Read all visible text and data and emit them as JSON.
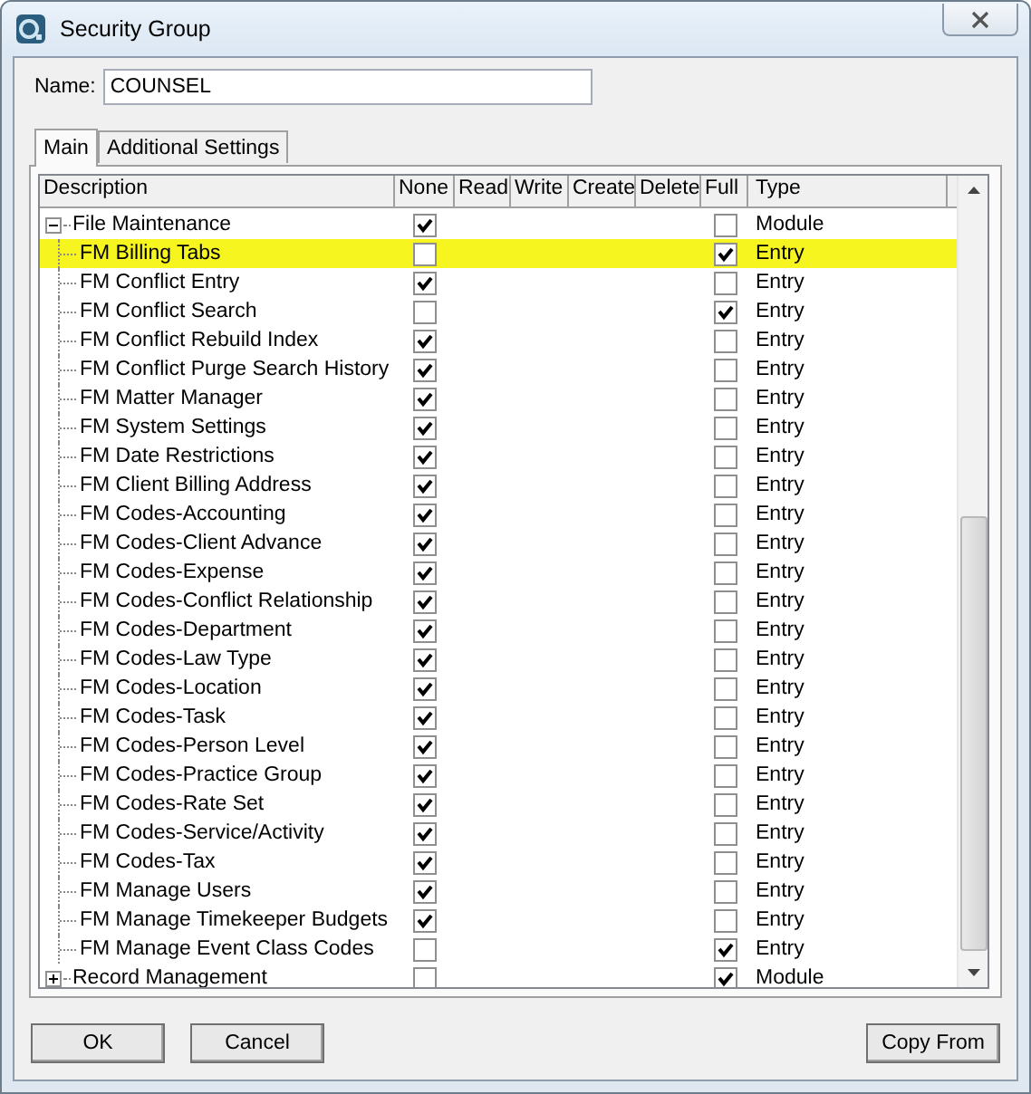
{
  "window": {
    "title": "Security Group"
  },
  "name_field": {
    "label": "Name:",
    "value": "COUNSEL"
  },
  "tabs": [
    {
      "label": "Main",
      "selected": true
    },
    {
      "label": "Additional Settings",
      "selected": false
    }
  ],
  "table": {
    "columns": [
      "Description",
      "None",
      "Read",
      "Write",
      "Create",
      "Delete",
      "Full",
      "Type"
    ],
    "rows": [
      {
        "description": "File Maintenance",
        "expanded": true,
        "none": true,
        "full": false,
        "type": "Module",
        "highlighted": false,
        "children": [
          {
            "description": "FM Billing Tabs",
            "none": false,
            "full": true,
            "type": "Entry",
            "highlighted": true
          },
          {
            "description": "FM Conflict Entry",
            "none": true,
            "full": false,
            "type": "Entry",
            "highlighted": false
          },
          {
            "description": "FM Conflict Search",
            "none": false,
            "full": true,
            "type": "Entry",
            "highlighted": false
          },
          {
            "description": "FM Conflict Rebuild Index",
            "none": true,
            "full": false,
            "type": "Entry",
            "highlighted": false
          },
          {
            "description": "FM Conflict Purge Search History",
            "none": true,
            "full": false,
            "type": "Entry",
            "highlighted": false
          },
          {
            "description": "FM Matter Manager",
            "none": true,
            "full": false,
            "type": "Entry",
            "highlighted": false
          },
          {
            "description": "FM System Settings",
            "none": true,
            "full": false,
            "type": "Entry",
            "highlighted": false
          },
          {
            "description": "FM Date Restrictions",
            "none": true,
            "full": false,
            "type": "Entry",
            "highlighted": false
          },
          {
            "description": "FM Client Billing Address",
            "none": true,
            "full": false,
            "type": "Entry",
            "highlighted": false
          },
          {
            "description": "FM Codes-Accounting",
            "none": true,
            "full": false,
            "type": "Entry",
            "highlighted": false
          },
          {
            "description": "FM Codes-Client Advance",
            "none": true,
            "full": false,
            "type": "Entry",
            "highlighted": false
          },
          {
            "description": "FM Codes-Expense",
            "none": true,
            "full": false,
            "type": "Entry",
            "highlighted": false
          },
          {
            "description": "FM Codes-Conflict Relationship",
            "none": true,
            "full": false,
            "type": "Entry",
            "highlighted": false
          },
          {
            "description": "FM Codes-Department",
            "none": true,
            "full": false,
            "type": "Entry",
            "highlighted": false
          },
          {
            "description": "FM Codes-Law Type",
            "none": true,
            "full": false,
            "type": "Entry",
            "highlighted": false
          },
          {
            "description": "FM Codes-Location",
            "none": true,
            "full": false,
            "type": "Entry",
            "highlighted": false
          },
          {
            "description": "FM Codes-Task",
            "none": true,
            "full": false,
            "type": "Entry",
            "highlighted": false
          },
          {
            "description": "FM Codes-Person Level",
            "none": true,
            "full": false,
            "type": "Entry",
            "highlighted": false
          },
          {
            "description": "FM Codes-Practice Group",
            "none": true,
            "full": false,
            "type": "Entry",
            "highlighted": false
          },
          {
            "description": "FM Codes-Rate Set",
            "none": true,
            "full": false,
            "type": "Entry",
            "highlighted": false
          },
          {
            "description": "FM Codes-Service/Activity",
            "none": true,
            "full": false,
            "type": "Entry",
            "highlighted": false
          },
          {
            "description": "FM Codes-Tax",
            "none": true,
            "full": false,
            "type": "Entry",
            "highlighted": false
          },
          {
            "description": "FM Manage Users",
            "none": true,
            "full": false,
            "type": "Entry",
            "highlighted": false
          },
          {
            "description": "FM Manage Timekeeper Budgets",
            "none": true,
            "full": false,
            "type": "Entry",
            "highlighted": false
          },
          {
            "description": "FM Manage Event Class Codes",
            "none": false,
            "full": true,
            "type": "Entry",
            "highlighted": false
          }
        ]
      },
      {
        "description": "Record Management",
        "expanded": false,
        "none": false,
        "full": true,
        "type": "Module",
        "highlighted": false
      }
    ]
  },
  "buttons": [
    {
      "label": "OK"
    },
    {
      "label": "Cancel"
    },
    {
      "label": "Copy From"
    }
  ]
}
